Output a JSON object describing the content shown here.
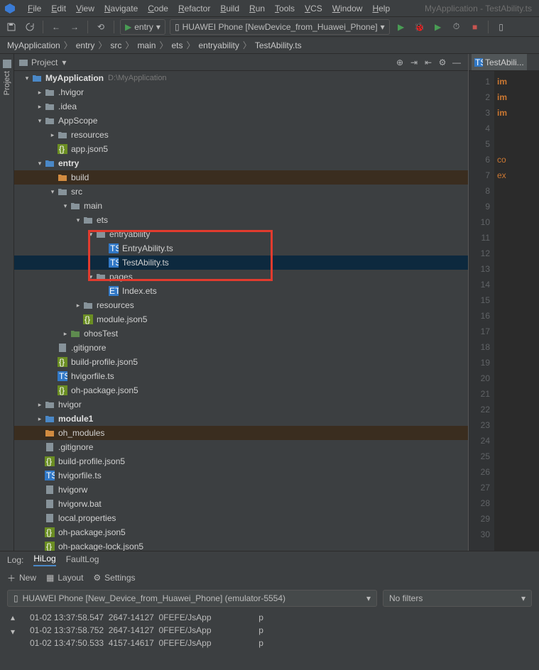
{
  "app_title": "MyApplication - TestAbility.ts",
  "menu": [
    "File",
    "Edit",
    "View",
    "Navigate",
    "Code",
    "Refactor",
    "Build",
    "Run",
    "Tools",
    "VCS",
    "Window",
    "Help"
  ],
  "run_config": "entry",
  "device": "HUAWEI Phone [NewDevice_from_Huawei_Phone]",
  "breadcrumbs": [
    "MyApplication",
    "entry",
    "src",
    "main",
    "ets",
    "entryability",
    "TestAbility.ts"
  ],
  "project_panel_title": "Project",
  "left_rail_label": "Project",
  "tree": [
    {
      "depth": 0,
      "arrow": "down",
      "icon": "folder-blue",
      "label": "MyApplication",
      "bold": true,
      "sub": "D:\\MyApplication"
    },
    {
      "depth": 1,
      "arrow": "right",
      "icon": "folder",
      "label": ".hvigor"
    },
    {
      "depth": 1,
      "arrow": "right",
      "icon": "folder",
      "label": ".idea"
    },
    {
      "depth": 1,
      "arrow": "down",
      "icon": "folder",
      "label": "AppScope"
    },
    {
      "depth": 2,
      "arrow": "right",
      "icon": "folder",
      "label": "resources"
    },
    {
      "depth": 2,
      "arrow": "",
      "icon": "json",
      "label": "app.json5"
    },
    {
      "depth": 1,
      "arrow": "down",
      "icon": "folder-blue",
      "label": "entry",
      "bold": true
    },
    {
      "depth": 2,
      "arrow": "",
      "icon": "folder-orange",
      "label": "build",
      "hl": "orange"
    },
    {
      "depth": 2,
      "arrow": "down",
      "icon": "folder",
      "label": "src"
    },
    {
      "depth": 3,
      "arrow": "down",
      "icon": "folder",
      "label": "main"
    },
    {
      "depth": 4,
      "arrow": "down",
      "icon": "folder",
      "label": "ets"
    },
    {
      "depth": 5,
      "arrow": "down",
      "icon": "folder",
      "label": "entryability"
    },
    {
      "depth": 6,
      "arrow": "",
      "icon": "ts",
      "label": "EntryAbility.ts"
    },
    {
      "depth": 6,
      "arrow": "",
      "icon": "ts",
      "label": "TestAbility.ts",
      "selected": true
    },
    {
      "depth": 5,
      "arrow": "down",
      "icon": "folder",
      "label": "pages"
    },
    {
      "depth": 6,
      "arrow": "",
      "icon": "ets",
      "label": "Index.ets"
    },
    {
      "depth": 4,
      "arrow": "right",
      "icon": "folder",
      "label": "resources"
    },
    {
      "depth": 4,
      "arrow": "",
      "icon": "json",
      "label": "module.json5"
    },
    {
      "depth": 3,
      "arrow": "right",
      "icon": "folder-green",
      "label": "ohosTest"
    },
    {
      "depth": 2,
      "arrow": "",
      "icon": "file",
      "label": ".gitignore"
    },
    {
      "depth": 2,
      "arrow": "",
      "icon": "json",
      "label": "build-profile.json5"
    },
    {
      "depth": 2,
      "arrow": "",
      "icon": "ts",
      "label": "hvigorfile.ts"
    },
    {
      "depth": 2,
      "arrow": "",
      "icon": "json",
      "label": "oh-package.json5"
    },
    {
      "depth": 1,
      "arrow": "right",
      "icon": "folder",
      "label": "hvigor"
    },
    {
      "depth": 1,
      "arrow": "right",
      "icon": "folder-blue",
      "label": "module1",
      "bold": true
    },
    {
      "depth": 1,
      "arrow": "",
      "icon": "folder-orange",
      "label": "oh_modules",
      "hl": "orange"
    },
    {
      "depth": 1,
      "arrow": "",
      "icon": "file",
      "label": ".gitignore"
    },
    {
      "depth": 1,
      "arrow": "",
      "icon": "json",
      "label": "build-profile.json5"
    },
    {
      "depth": 1,
      "arrow": "",
      "icon": "ts",
      "label": "hvigorfile.ts"
    },
    {
      "depth": 1,
      "arrow": "",
      "icon": "file",
      "label": "hvigorw"
    },
    {
      "depth": 1,
      "arrow": "",
      "icon": "file",
      "label": "hvigorw.bat"
    },
    {
      "depth": 1,
      "arrow": "",
      "icon": "file",
      "label": "local.properties"
    },
    {
      "depth": 1,
      "arrow": "",
      "icon": "json",
      "label": "oh-package.json5"
    },
    {
      "depth": 1,
      "arrow": "",
      "icon": "json",
      "label": "oh-package-lock.json5"
    }
  ],
  "editor_tab": "TestAbili...",
  "gutter_lines": 30,
  "code_fragments": {
    "l1": "im",
    "l2": "",
    "l3": "im",
    "l4": "im",
    "l5": "",
    "l6": "",
    "l7": "co",
    "l8": "ex"
  },
  "log": {
    "label": "Log:",
    "tabs": [
      "HiLog",
      "FaultLog"
    ],
    "active_tab": "HiLog",
    "toolbar": {
      "new": "New",
      "layout": "Layout",
      "settings": "Settings"
    },
    "device_filter": "HUAWEI Phone [New_Device_from_Huawei_Phone] (emulator-5554)",
    "text_filter": "No filters",
    "lines": [
      "01-02 13:37:58.547  2647-14127  0FEFE/JsApp                    p",
      "01-02 13:37:58.752  2647-14127  0FEFE/JsApp                    p",
      "01-02 13:47:50.533  4157-14617  0FEFE/JsApp                    p"
    ]
  }
}
